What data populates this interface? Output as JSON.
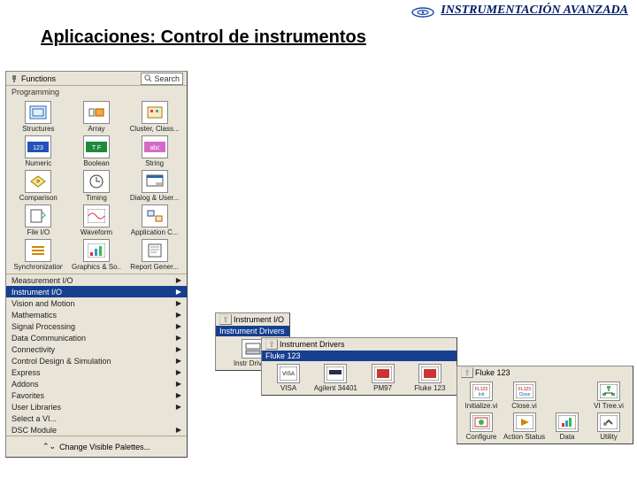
{
  "header": {
    "title": "INSTRUMENTACIÓN AVANZADA"
  },
  "page_title": "Aplicaciones: Control de instrumentos",
  "functions_panel": {
    "title": "Functions",
    "search_label": "Search",
    "section_label": "Programming",
    "grid": [
      {
        "label": "Structures"
      },
      {
        "label": "Array"
      },
      {
        "label": "Cluster, Class..."
      },
      {
        "label": "Numeric"
      },
      {
        "label": "Boolean"
      },
      {
        "label": "String"
      },
      {
        "label": "Comparison"
      },
      {
        "label": "Timing"
      },
      {
        "label": "Dialog & User..."
      },
      {
        "label": "File I/O"
      },
      {
        "label": "Waveform"
      },
      {
        "label": "Application C..."
      },
      {
        "label": "Synchronization"
      },
      {
        "label": "Graphics & So..."
      },
      {
        "label": "Report Gener..."
      }
    ],
    "list": [
      {
        "label": "Measurement I/O",
        "selected": false
      },
      {
        "label": "Instrument I/O",
        "selected": true
      },
      {
        "label": "Vision and Motion",
        "selected": false
      },
      {
        "label": "Mathematics",
        "selected": false
      },
      {
        "label": "Signal Processing",
        "selected": false
      },
      {
        "label": "Data Communication",
        "selected": false
      },
      {
        "label": "Connectivity",
        "selected": false
      },
      {
        "label": "Control Design & Simulation",
        "selected": false
      },
      {
        "label": "Express",
        "selected": false
      },
      {
        "label": "Addons",
        "selected": false
      },
      {
        "label": "Favorites",
        "selected": false
      },
      {
        "label": "User Libraries",
        "selected": false
      },
      {
        "label": "Select a VI...",
        "selected": false
      },
      {
        "label": "DSC Module",
        "selected": false
      }
    ],
    "footer_label": "Change Visible Palettes..."
  },
  "instrument_io_panel": {
    "header": "Instrument I/O",
    "title": "Instrument Drivers",
    "items": [
      {
        "label": "Instr Drivers"
      }
    ]
  },
  "instrument_drivers_panel": {
    "header": "Instrument Drivers",
    "title": "Fluke 123",
    "items": [
      {
        "label": "VISA"
      },
      {
        "label": "Agilent 34401"
      },
      {
        "label": "PM97"
      },
      {
        "label": "Fluke 123"
      }
    ]
  },
  "fluke_panel": {
    "header": "Fluke 123",
    "row1": [
      {
        "label": "Initialize.vi"
      },
      {
        "label": "Close.vi"
      },
      {
        "label": "VI Tree.vi"
      }
    ],
    "row2": [
      {
        "label": "Configure"
      },
      {
        "label": "Action Status"
      },
      {
        "label": "Data"
      },
      {
        "label": "Utility"
      }
    ]
  }
}
